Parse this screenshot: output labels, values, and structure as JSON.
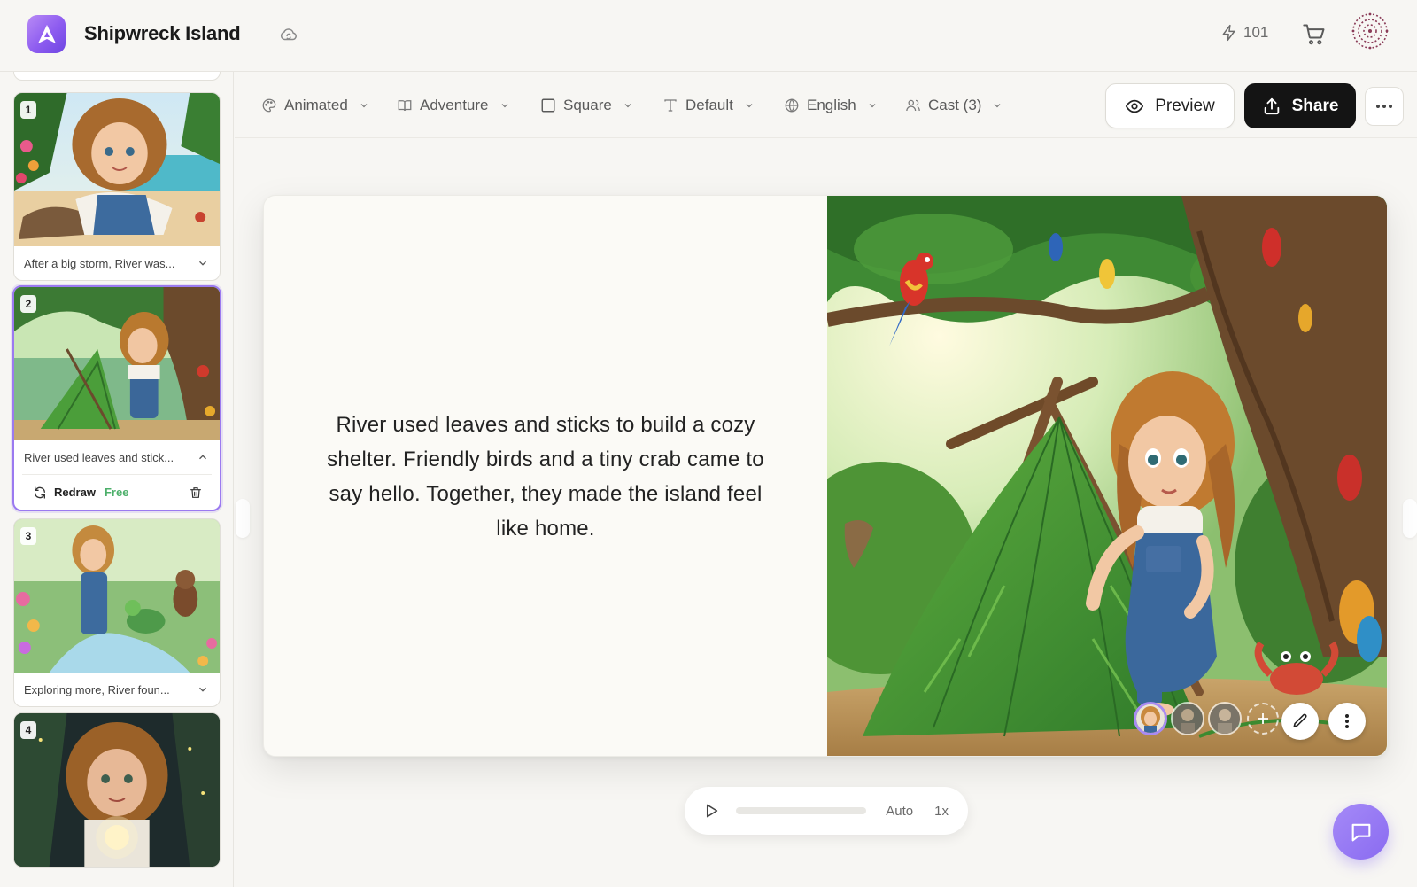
{
  "header": {
    "title": "Shipwreck Island",
    "credits": "101"
  },
  "toolbar": {
    "style": "Animated",
    "genre": "Adventure",
    "format": "Square",
    "font": "Default",
    "language": "English",
    "cast": "Cast (3)",
    "preview": "Preview",
    "share": "Share"
  },
  "pages": [
    {
      "number": "1",
      "caption": "After a big storm, River was..."
    },
    {
      "number": "2",
      "caption": "River used leaves and stick...",
      "redraw": "Redraw",
      "free": "Free"
    },
    {
      "number": "3",
      "caption": "Exploring more, River foun..."
    },
    {
      "number": "4"
    }
  ],
  "spread": {
    "text": "River used leaves and sticks to build a cozy shelter. Friendly birds and a tiny crab came to say hello. Together, they made the island feel like home."
  },
  "player": {
    "mode": "Auto",
    "speed": "1x",
    "progress": 0.0
  },
  "colors": {
    "accent": "#8d5cf0",
    "selected_border": "#9b7af0",
    "free_green": "#4caf6a",
    "share_bg": "#141414"
  },
  "icons": [
    "cloud-sync-icon",
    "bolt-icon",
    "cart-icon",
    "palette-icon",
    "book-icon",
    "square-icon",
    "text-icon",
    "globe-icon",
    "users-icon",
    "eye-icon",
    "upload-icon",
    "ellipsis-icon",
    "refresh-icon",
    "trash-icon",
    "pencil-icon",
    "kebab-icon",
    "play-icon",
    "chat-icon"
  ]
}
